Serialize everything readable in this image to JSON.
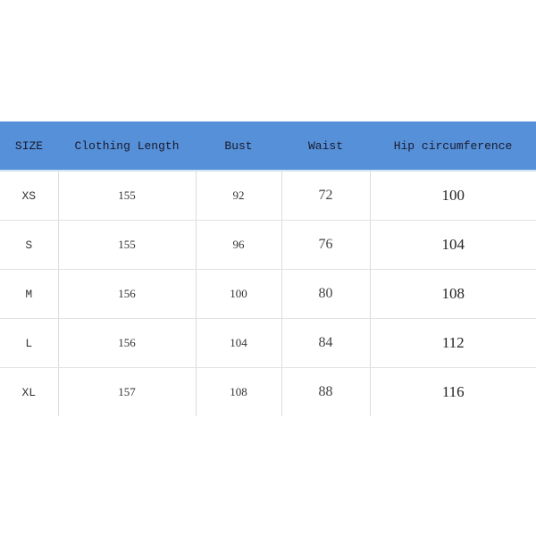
{
  "headers": [
    "SIZE",
    "Clothing Length",
    "Bust",
    "Waist",
    "Hip circumference"
  ],
  "rows": [
    [
      "XS",
      "155",
      "92",
      "72",
      "100"
    ],
    [
      "S",
      "155",
      "96",
      "76",
      "104"
    ],
    [
      "M",
      "156",
      "100",
      "80",
      "108"
    ],
    [
      "L",
      "156",
      "104",
      "84",
      "112"
    ],
    [
      "XL",
      "157",
      "108",
      "88",
      "116"
    ]
  ],
  "colors": {
    "header_bg": "#5590d8"
  }
}
